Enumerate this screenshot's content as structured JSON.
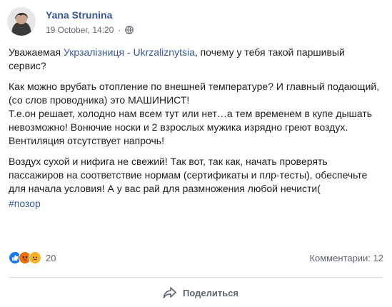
{
  "post": {
    "author": "Yana Strunina",
    "date": "19 October, 14:20",
    "separator": "·",
    "privacy_icon": "globe-icon",
    "paragraphs": {
      "p1": {
        "prefix": "Уважаемая ",
        "mention": "Укрзалізниця - Ukrzaliznytsia",
        "suffix": ", почему у тебя такой паршивый сервис?"
      },
      "p2_l1": "Как можно врубать отопление по внешней температуре? И главный подающий, (со слов проводника) это МАШИНИСТ!",
      "p2_l2": "Т.е.он решает, холодно нам всем тут или нет…а тем временем в купе дышать невозможно! Вонючие носки и 2 взрослых мужика изрядно греют воздух. Вентиляция отсутствует напрочь!",
      "p3": "Воздух сухой и нифига не свежий! Так вот, так как, начать проверять пассажиров на соответствие нормам (сертификаты и плр-тесты), обеспечьте для начала условия! А у вас рай для размножения любой нечисти(",
      "hashtag": "#позор"
    }
  },
  "reactions": {
    "icons": [
      "like-icon",
      "angry-icon",
      "sad-icon"
    ],
    "count": "20",
    "comments": "Комментарии: 12"
  },
  "actions": {
    "share_label": "Поделиться",
    "share_icon": "share-icon"
  },
  "colors": {
    "link": "#385898",
    "text": "#1c1e21",
    "muted": "#606770",
    "like": "#1877f2",
    "angry": "#e9710f",
    "sad": "#f7b125"
  }
}
